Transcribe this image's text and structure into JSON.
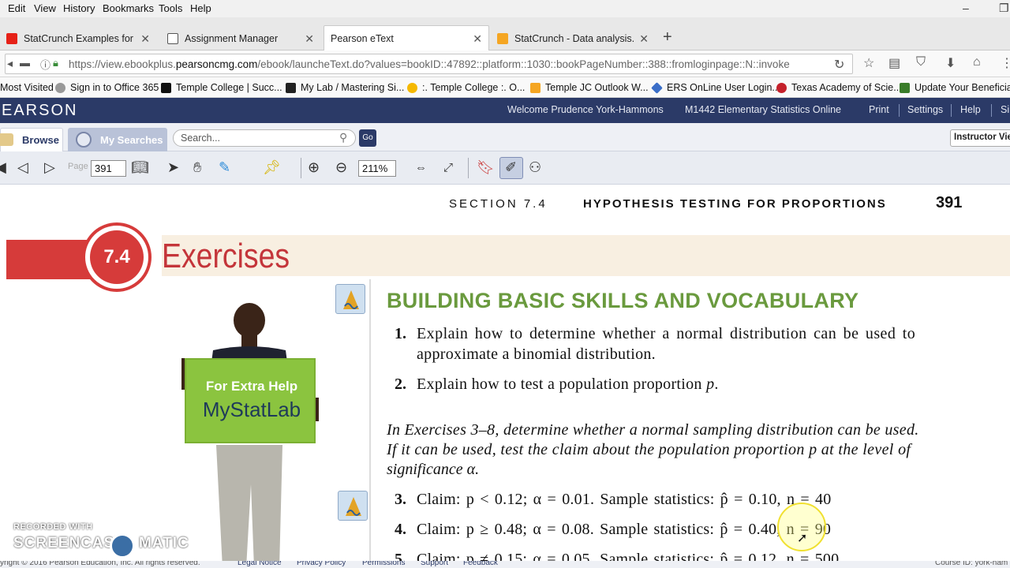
{
  "menubar": {
    "items": [
      "Edit",
      "View",
      "History",
      "Bookmarks",
      "Tools",
      "Help"
    ]
  },
  "tabs": [
    {
      "label": "StatCrunch Examples for ...",
      "favicon_color": "#e62117"
    },
    {
      "label": "Assignment Manager",
      "favicon_color": "#555555"
    },
    {
      "label": "Pearson eText",
      "favicon_color": "#ffffff"
    },
    {
      "label": "StatCrunch - Data analysis...",
      "favicon_color": "#f5a623"
    }
  ],
  "url": {
    "prefix": "https://view.ebookplus.",
    "host": "pearsoncmg.com",
    "path": "/ebook/launcheText.do?values=bookID::47892::platform::1030::bookPageNumber::388::fromloginpage::N::invoke"
  },
  "bookmarks": [
    {
      "label": "Most Visited",
      "icon": "gear-icon",
      "color": "#777777"
    },
    {
      "label": "Sign in to Office 365",
      "icon": "globe-icon",
      "color": "#777777"
    },
    {
      "label": "Temple College | Succ...",
      "icon": "tc-icon",
      "color": "#111111"
    },
    {
      "label": "My Lab / Mastering Si...",
      "icon": "p-icon",
      "color": "#222222"
    },
    {
      "label": ":. Temple College :. O...",
      "icon": "star-icon",
      "color": "#f5b800"
    },
    {
      "label": "Temple JC Outlook W...",
      "icon": "outlook-icon",
      "color": "#f5a623"
    },
    {
      "label": "ERS OnLine User Login...",
      "icon": "diamond-icon",
      "color": "#3a6ec8"
    },
    {
      "label": "Texas Academy of Scie...",
      "icon": "circle-icon",
      "color": "#c4202a"
    },
    {
      "label": "Update Your Beneficia...",
      "icon": "tree-icon",
      "color": "#3a7d2a"
    }
  ],
  "pearson": {
    "logo": "EARSON",
    "welcome": "Welcome Prudence York-Hammons",
    "course": "M1442 Elementary Statistics Online",
    "print": "Print",
    "settings": "Settings",
    "help": "Help",
    "signout": "Si"
  },
  "browse": {
    "browse_label": "Browse",
    "mysearches_label": "My Searches",
    "search_placeholder": "Search...",
    "go_label": "Go",
    "instructor_view": "Instructor Vie"
  },
  "toolbar": {
    "page_label": "Page",
    "page_value": "391",
    "zoom_value": "211%"
  },
  "page": {
    "section_label": "SECTION 7.4",
    "section_title": "HYPOTHESIS TESTING FOR PROPORTIONS",
    "page_number": "391",
    "badge": "7.4",
    "exercises_title": "Exercises",
    "mystatlab_line1": "For Extra Help",
    "mystatlab_line2": "MyStatLab",
    "heading": "BUILDING BASIC SKILLS AND VOCABULARY",
    "ex1_num": "1.",
    "ex1_line1": "Explain how to determine whether a normal distribution can be used to",
    "ex1_line2": "approximate a binomial distribution.",
    "ex2_num": "2.",
    "ex2_text": "Explain how to test a population proportion",
    "ex2_var": "p",
    "ex2_end": ".",
    "instr_line1": "In Exercises 3–8, determine whether a normal sampling distribution can be used.",
    "instr_line2": "If it can be used, test the claim about the population proportion p at the level of",
    "instr_line3": "significance α.",
    "ex3_num": "3.",
    "ex3_text": "Claim: p < 0.12; α = 0.01. Sample statistics: p̂ = 0.10, n = 40",
    "ex4_num": "4.",
    "ex4_text": "Claim: p ≥ 0.48; α = 0.08. Sample statistics: p̂ = 0.40, n = 90",
    "ex5_num": "5.",
    "ex5_text": "Claim: p ≠ 0.15; α = 0.05. Sample statistics: p̂ = 0.12, n = 500"
  },
  "watermark": {
    "line1": "RECORDED WITH",
    "line2": "SCREENCAST",
    "line3": "MATIC"
  },
  "footer": {
    "copyright": "yright © 2016 Pearson Education, Inc. All rights reserved.",
    "links": [
      "Legal Notice",
      "Privacy Policy",
      "Permissions",
      "Support",
      "Feedback"
    ],
    "course_id": "Course ID: york-ham"
  }
}
